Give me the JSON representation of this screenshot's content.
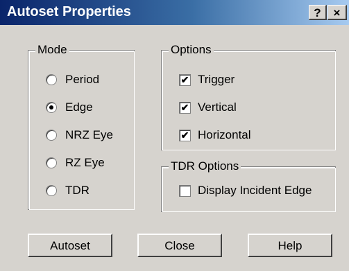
{
  "window": {
    "title": "Autoset Properties",
    "help_label": "?",
    "close_label": "×"
  },
  "mode": {
    "legend": "Mode",
    "options": [
      {
        "label": "Period",
        "selected": false
      },
      {
        "label": "Edge",
        "selected": true
      },
      {
        "label": "NRZ Eye",
        "selected": false
      },
      {
        "label": "RZ Eye",
        "selected": false
      },
      {
        "label": "TDR",
        "selected": false
      }
    ]
  },
  "options": {
    "legend": "Options",
    "items": [
      {
        "label": "Trigger",
        "checked": true
      },
      {
        "label": "Vertical",
        "checked": true
      },
      {
        "label": "Horizontal",
        "checked": true
      }
    ]
  },
  "tdr_options": {
    "legend": "TDR Options",
    "items": [
      {
        "label": "Display Incident Edge",
        "checked": false
      }
    ]
  },
  "buttons": {
    "autoset": "Autoset",
    "close": "Close",
    "help": "Help"
  },
  "marks": {
    "check": "✔"
  }
}
